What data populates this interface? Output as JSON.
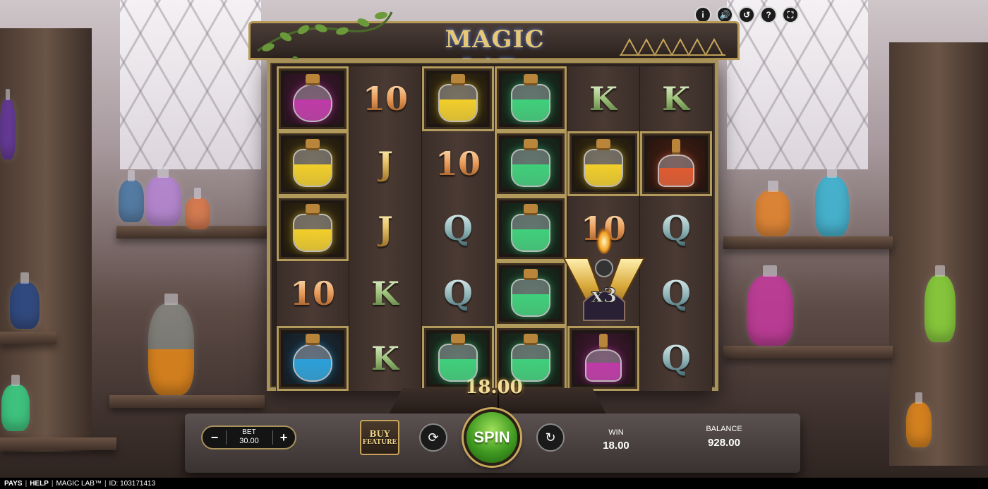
{
  "game": {
    "title": "MAGIC LAB",
    "trademark": "™"
  },
  "top_icons": [
    {
      "name": "info-icon",
      "glyph": "i"
    },
    {
      "name": "sound-icon",
      "glyph": "🔊"
    },
    {
      "name": "history-icon",
      "glyph": "↺"
    },
    {
      "name": "help-icon",
      "glyph": "?"
    },
    {
      "name": "fullscreen-icon",
      "glyph": "⛶"
    }
  ],
  "reels": [
    [
      {
        "type": "potion",
        "color": "#c03aa8",
        "shape": "round",
        "frame": "purple"
      },
      {
        "type": "potion",
        "color": "#f2cf2a",
        "shape": "jar",
        "frame": "yellow"
      },
      {
        "type": "potion",
        "color": "#f2cf2a",
        "shape": "jar",
        "frame": "yellow"
      },
      {
        "type": "letter",
        "value": "10",
        "kind": "ten"
      },
      {
        "type": "potion",
        "color": "#2aa0d8",
        "shape": "round",
        "frame": "blue"
      }
    ],
    [
      {
        "type": "letter",
        "value": "10",
        "kind": "ten"
      },
      {
        "type": "letter",
        "value": "J",
        "kind": "j"
      },
      {
        "type": "letter",
        "value": "J",
        "kind": "j"
      },
      {
        "type": "letter",
        "value": "K",
        "kind": "k"
      },
      {
        "type": "letter",
        "value": "K",
        "kind": "k"
      }
    ],
    [
      {
        "type": "potion",
        "color": "#f2cf2a",
        "shape": "jar",
        "frame": "yellow"
      },
      {
        "type": "letter",
        "value": "10",
        "kind": "ten"
      },
      {
        "type": "letter",
        "value": "Q",
        "kind": "q"
      },
      {
        "type": "letter",
        "value": "Q",
        "kind": "q"
      },
      {
        "type": "potion",
        "color": "#3fd07a",
        "shape": "jar",
        "frame": "green"
      }
    ],
    [
      {
        "type": "potion",
        "color": "#3fd07a",
        "shape": "jar",
        "frame": "green"
      },
      {
        "type": "potion",
        "color": "#3fd07a",
        "shape": "jar",
        "frame": "green"
      },
      {
        "type": "potion",
        "color": "#3fd07a",
        "shape": "jar",
        "frame": "green"
      },
      {
        "type": "potion",
        "color": "#3fd07a",
        "shape": "jar",
        "frame": "green"
      },
      {
        "type": "potion",
        "color": "#3fd07a",
        "shape": "jar",
        "frame": "green"
      }
    ],
    [
      {
        "type": "letter",
        "value": "K",
        "kind": "k"
      },
      {
        "type": "potion",
        "color": "#f2cf2a",
        "shape": "jar",
        "frame": "yellow"
      },
      {
        "type": "letter",
        "value": "10",
        "kind": "ten"
      },
      {
        "type": "wild-slot"
      },
      {
        "type": "potion",
        "color": "#c03aa8",
        "shape": "flask",
        "frame": "purple"
      }
    ],
    [
      {
        "type": "letter",
        "value": "K",
        "kind": "k"
      },
      {
        "type": "potion",
        "color": "#e05a30",
        "shape": "flask",
        "frame": "red"
      },
      {
        "type": "letter",
        "value": "Q",
        "kind": "q"
      },
      {
        "type": "letter",
        "value": "Q",
        "kind": "q"
      },
      {
        "type": "letter",
        "value": "Q",
        "kind": "q"
      }
    ]
  ],
  "wild": {
    "multiplier": "x3"
  },
  "win_display": "18.00",
  "controls": {
    "bet_label": "BET",
    "bet_value": "30.00",
    "minus": "−",
    "plus": "+",
    "buy_line1": "BUY",
    "buy_line2": "FEATURE",
    "turbo_glyph": "⟳",
    "spin_label": "SPIN",
    "autoplay_glyph": "↻",
    "win_label": "WIN",
    "win_value": "18.00",
    "balance_label": "BALANCE",
    "balance_value": "928.00"
  },
  "footer": {
    "pays": "PAYS",
    "help": "HELP",
    "game_name": "MAGIC LAB™",
    "id_text": "ID: 103171413"
  }
}
